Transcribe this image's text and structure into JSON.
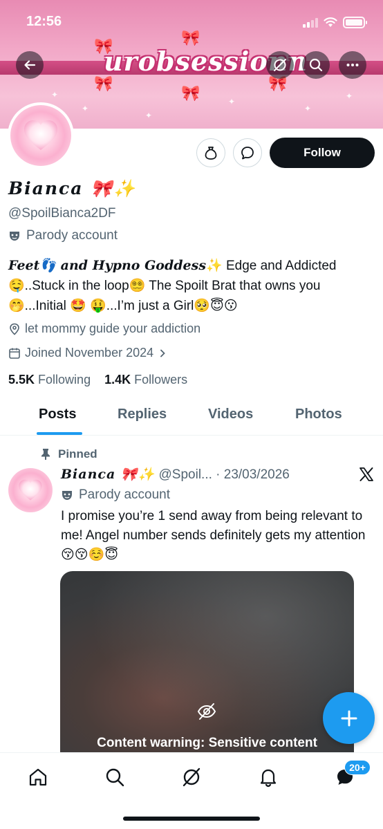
{
  "status_bar": {
    "time": "12:56"
  },
  "banner": {
    "text": "urobsessionn"
  },
  "profile": {
    "name": "Bianca 🎀✨",
    "handle": "@SpoilBianca2DF",
    "parody_label": "Parody account",
    "follow_label": "Follow",
    "bio": {
      "fancy_prefix": "Feet👣 and Hypno Goddess",
      "line_rest": "✨ Edge and Addicted 🤤..Stuck in the loop😵‍💫 The Spoilt Brat that owns you 🤭...Initial 🤩 🤑...I’m just a Girl🥺😇😗"
    },
    "location": "let mommy guide your addiction",
    "joined": "Joined November 2024",
    "following_count": "5.5K",
    "following_label": "Following",
    "followers_count": "1.4K",
    "followers_label": "Followers"
  },
  "tabs": [
    {
      "label": "Posts"
    },
    {
      "label": "Replies"
    },
    {
      "label": "Videos"
    },
    {
      "label": "Photos"
    }
  ],
  "post": {
    "pinned_label": "Pinned",
    "author_name": "Bianca 🎀✨",
    "author_handle": "@Spoil...",
    "separator": "·",
    "date": "23/03/2026",
    "parody_label": "Parody account",
    "text": "I promise you’re 1 send away from being relevant to me! Angel number sends definitely gets my attention 😚😚☺️😇",
    "media_warning": "Content warning: Sensitive content"
  },
  "bottom_nav": {
    "notification_badge": "20+"
  },
  "colors": {
    "accent": "#1d9bf0",
    "text": "#0f1419",
    "secondary_text": "#536471",
    "banner_pink": "#f2a9c8"
  },
  "icons": [
    "back-arrow-icon",
    "grok-icon",
    "search-icon",
    "more-icon",
    "money-bag-icon",
    "message-icon",
    "mask-icon",
    "location-pin-icon",
    "calendar-icon",
    "chevron-right-icon",
    "pin-icon",
    "x-logo-icon",
    "eye-slash-icon",
    "plus-icon",
    "home-icon",
    "notifications-bell-icon",
    "messages-icon"
  ]
}
